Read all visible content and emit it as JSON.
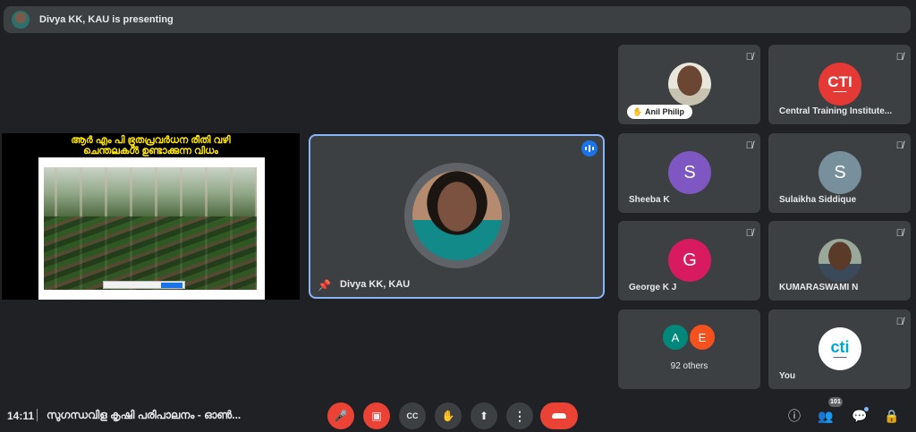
{
  "header": {
    "presenting_text": "Divya KK, KAU is presenting"
  },
  "slide": {
    "title_line1": "ആർ എം പി ഭ്രൂതപ്രവർധന രീതി വഴി",
    "title_line2": "ചെന്തലകൾ ഉണ്ടാക്കുന്ന വിധം"
  },
  "main": {
    "name": "Divya KK, KAU"
  },
  "tiles": [
    {
      "name": "Anil Philip",
      "hand_raised": true
    },
    {
      "name": "Central Training Institute...",
      "logo_text": "CTI"
    },
    {
      "name": "Sheeba K",
      "initial": "S",
      "color": "#7e57c2"
    },
    {
      "name": "Sulaikha Siddique",
      "initial": "S",
      "color": "#78909c"
    },
    {
      "name": "George K J",
      "initial": "G",
      "color": "#d81b60"
    },
    {
      "name": "KUMARASWAMI N"
    },
    {
      "others_label": "92 others",
      "initials": [
        "A",
        "E"
      ],
      "colors": [
        "#00897b",
        "#f4511e"
      ]
    },
    {
      "name": "You",
      "logo_text": "cti"
    }
  ],
  "bottom": {
    "time": "14:11",
    "meeting_title": "സുഗന്ധവിള കൃഷി പരിപാലനം - ഓൺ...",
    "participants_count": "101"
  }
}
